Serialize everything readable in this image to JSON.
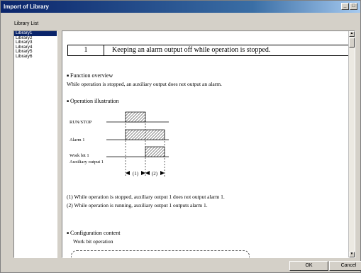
{
  "window": {
    "title": "Import of Library"
  },
  "library_list": {
    "label": "Library List",
    "items": [
      "Library1",
      "Library2",
      "Library3",
      "Library4",
      "Library5",
      "Library6"
    ],
    "selected_index": 0
  },
  "content": {
    "heading_number": "1",
    "heading_title": "Keeping an alarm output off while operation is stopped.",
    "function_overview_title": "Function overview",
    "function_overview_text": "While operation is stopped, an auxiliary output does not output an alarm.",
    "operation_illustration_title": "Operation illustration",
    "signals": {
      "run_stop": "RUN/STOP",
      "alarm1": "Alarm 1",
      "work_bit": "Work bit 1",
      "aux_output": "Auxiliary output 1"
    },
    "interval1": "(1)",
    "interval2": "(2)",
    "note1": "(1)  While operation is stopped, auxiliary output 1 does not output alarm 1.",
    "note2": "(2)  While operation is running, auxiliary output 1 outputs alarm 1.",
    "configuration_title": "Configuration content",
    "configuration_text": "Work bit operation",
    "bullet_glyph": "■"
  },
  "buttons": {
    "ok": "OK",
    "cancel": "Cancel"
  }
}
